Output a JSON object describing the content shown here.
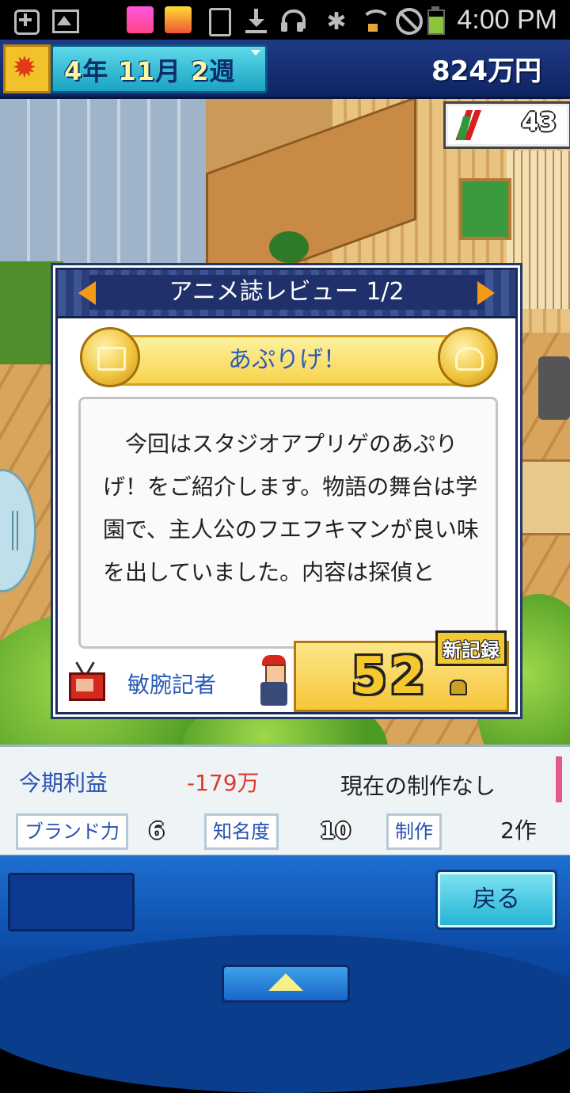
{
  "statusbar": {
    "time": "4:00 PM",
    "icons": [
      "plus-icon",
      "gallery-icon",
      "app-icon",
      "app-icon",
      "app-icon",
      "sim-icon",
      "download-icon",
      "headphones-icon",
      "bluetooth-icon",
      "wifi-icon",
      "mute-icon",
      "battery-icon"
    ],
    "bluetooth_glyph": "✱"
  },
  "topbar": {
    "year": "4",
    "year_unit": "年",
    "month": "11",
    "month_unit": "月",
    "week": "2",
    "week_unit": "週",
    "money": "824万円",
    "season_icon": "maple-leaf-icon",
    "season_glyph": "✹"
  },
  "fans": {
    "count": "43",
    "icon": "books-icon"
  },
  "dialog": {
    "title": "アニメ誌レビュー 1/2",
    "work_title": "あぷりげ！",
    "review_text": "　今回はスタジオアプリゲのあぷりげ！をご紹介します。物語の舞台は学園で、主人公のフエフキマンが良い味を出していました。内容は探偵と",
    "reporter": "敏腕記者",
    "score": "52",
    "record_label": "新記録"
  },
  "info": {
    "profit_label": "今期利益",
    "profit_value": "-179万",
    "production_status": "現在の制作なし",
    "brand_label": "ブランド力",
    "brand_value": "6",
    "fame_label": "知名度",
    "fame_value": "10",
    "works_label": "制作",
    "works_value": "2作"
  },
  "buttons": {
    "back": "戻る"
  },
  "colors": {
    "accent_blue": "#2750b0",
    "profit_negative": "#e0382c",
    "arrow_orange": "#f39a18"
  }
}
